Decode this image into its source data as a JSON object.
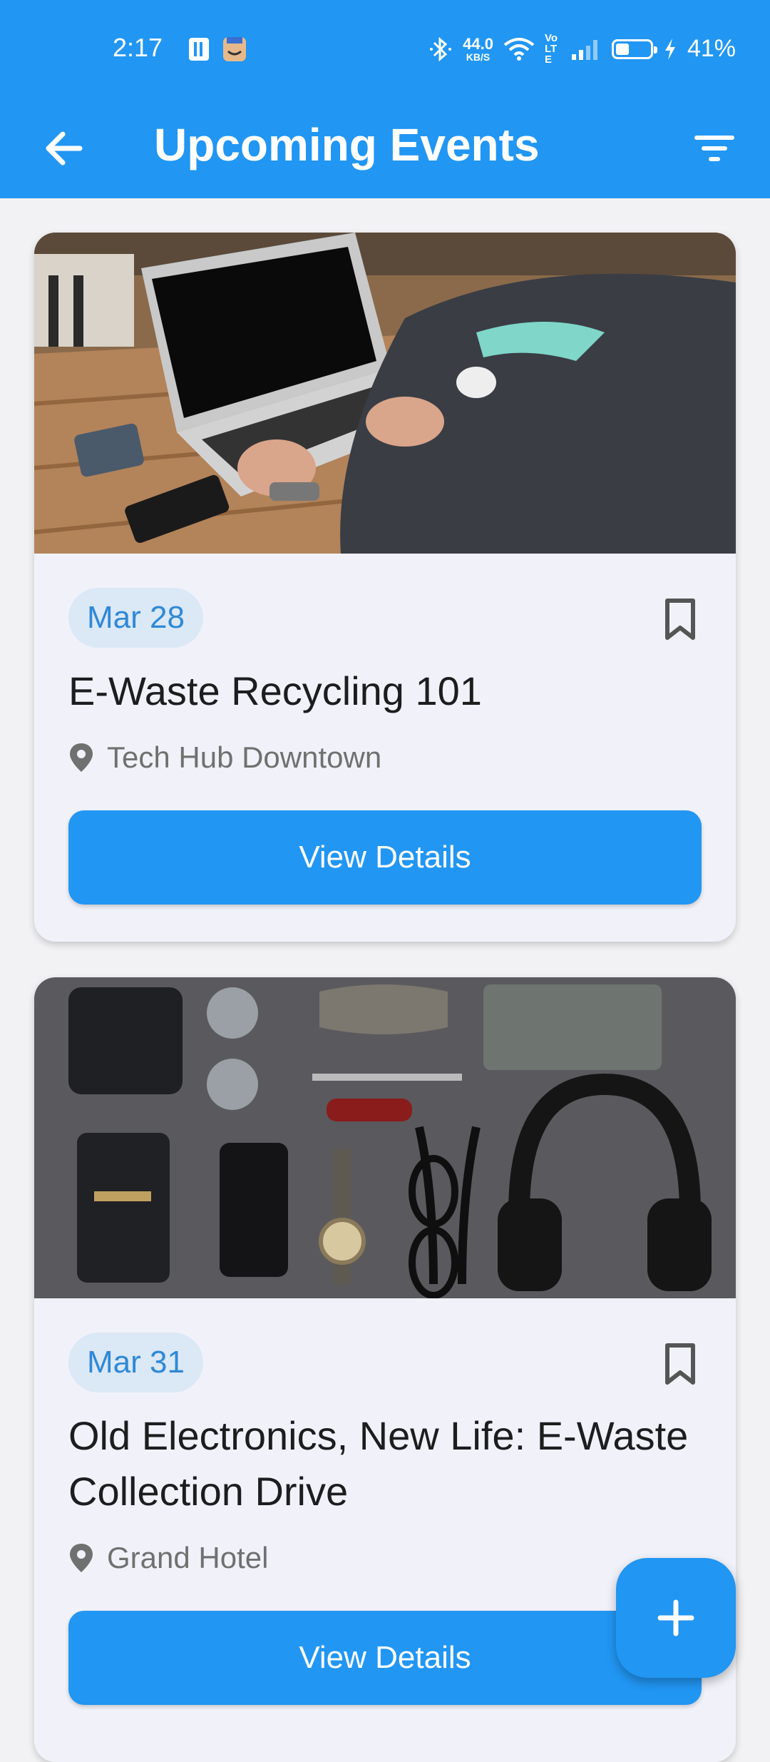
{
  "status_bar": {
    "time": "2:17",
    "net_speed_value": "44.0",
    "net_speed_unit": "KB/S",
    "lte_label": "Vo LTE",
    "battery": "41%",
    "battery_level": 0.41
  },
  "app_bar": {
    "title": "Upcoming Events",
    "back_icon": "arrow-back-icon",
    "filter_icon": "filter-icon"
  },
  "events": [
    {
      "date": "Mar 28",
      "title": "E-Waste Recycling 101",
      "location": "Tech Hub Downtown",
      "button_label": "View Details",
      "image": "laptop-desk-photo"
    },
    {
      "date": "Mar 31",
      "title": "Old Electronics, New Life: E-Waste Collection Drive",
      "location": "Grand Hotel",
      "button_label": "View Details",
      "image": "electronics-flatlay-photo"
    }
  ],
  "fab": {
    "icon": "plus-icon"
  },
  "colors": {
    "primary": "#2196f3",
    "chip_bg": "#dbe8f6",
    "chip_text": "#2f89d6",
    "card_bg": "#f1f2f9"
  }
}
